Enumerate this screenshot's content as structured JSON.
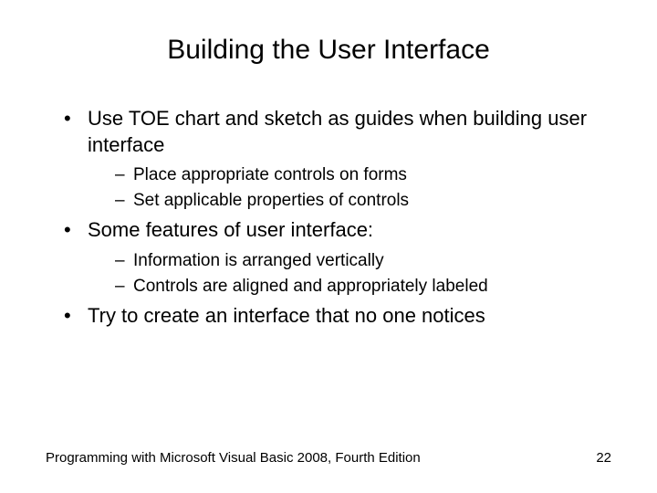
{
  "title": "Building the User Interface",
  "bullets": [
    {
      "text": "Use TOE chart and sketch as guides when building user interface",
      "sub": [
        "Place appropriate controls on forms",
        "Set applicable properties of controls"
      ]
    },
    {
      "text": "Some features of user interface:",
      "sub": [
        "Information is arranged vertically",
        "Controls are aligned and appropriately labeled"
      ]
    },
    {
      "text": "Try to create an interface that no one notices",
      "sub": []
    }
  ],
  "footer": {
    "left": "Programming with Microsoft Visual Basic 2008, Fourth Edition",
    "right": "22"
  }
}
